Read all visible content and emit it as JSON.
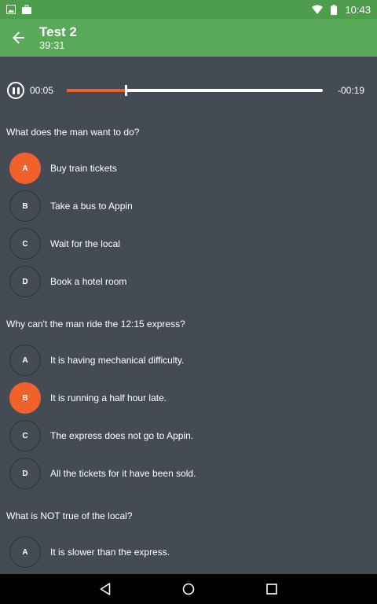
{
  "status_bar": {
    "time": "10:43"
  },
  "app_bar": {
    "title": "Test 2",
    "subtitle": "39:31"
  },
  "player": {
    "elapsed": "00:05",
    "remaining": "-00:19",
    "progress": 0.23
  },
  "colors": {
    "accent": "#f0612c",
    "app_bar": "#5aa95a",
    "background": "#454b55"
  },
  "questions": [
    {
      "text": "What does the man want to do?",
      "options": [
        {
          "letter": "A",
          "label": "Buy train tickets",
          "selected": true
        },
        {
          "letter": "B",
          "label": "Take a bus to Appin",
          "selected": false
        },
        {
          "letter": "C",
          "label": "Wait for the local",
          "selected": false
        },
        {
          "letter": "D",
          "label": "Book a hotel room",
          "selected": false
        }
      ]
    },
    {
      "text": "Why can't the man ride the 12:15 express?",
      "options": [
        {
          "letter": "A",
          "label": "It is having mechanical difficulty.",
          "selected": false
        },
        {
          "letter": "B",
          "label": "It is running a half hour late.",
          "selected": true
        },
        {
          "letter": "C",
          "label": "The express does not go to Appin.",
          "selected": false
        },
        {
          "letter": "D",
          "label": "All the tickets for it have been sold.",
          "selected": false
        }
      ]
    },
    {
      "text": "What is NOT true of the local?",
      "options": [
        {
          "letter": "A",
          "label": "It is slower than the express.",
          "selected": false
        }
      ]
    }
  ]
}
